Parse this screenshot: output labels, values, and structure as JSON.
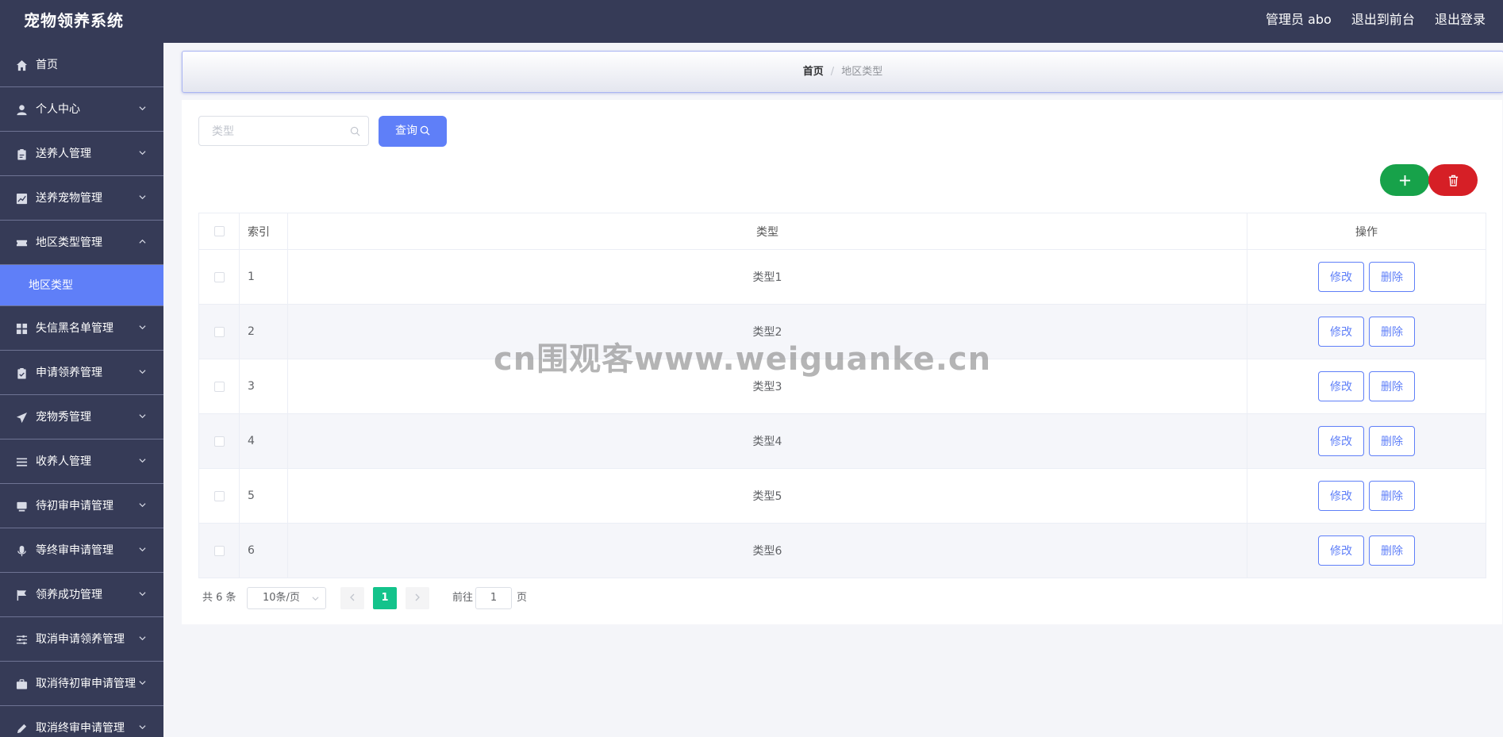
{
  "header": {
    "title": "宠物领养系统",
    "user": "管理员 abo",
    "front_link": "退出到前台",
    "logout_link": "退出登录"
  },
  "sidebar": {
    "items": [
      {
        "label": "首页",
        "icon": "home-icon"
      },
      {
        "label": "个人中心",
        "icon": "user-icon"
      },
      {
        "label": "送养人管理",
        "icon": "clipboard-icon"
      },
      {
        "label": "送养宠物管理",
        "icon": "chart-icon"
      },
      {
        "label": "地区类型管理",
        "icon": "ticket-icon",
        "expanded": true
      },
      {
        "label": "失信黑名单管理",
        "icon": "grid-icon"
      },
      {
        "label": "申请领养管理",
        "icon": "clipboard-check-icon"
      },
      {
        "label": "宠物秀管理",
        "icon": "send-icon"
      },
      {
        "label": "收养人管理",
        "icon": "list-icon"
      },
      {
        "label": "待初审申请管理",
        "icon": "monitor-icon"
      },
      {
        "label": "等终审申请管理",
        "icon": "microphone-icon"
      },
      {
        "label": "领养成功管理",
        "icon": "flag-icon"
      },
      {
        "label": "取消申请领养管理",
        "icon": "sliders-icon"
      },
      {
        "label": "取消待初审申请管理",
        "icon": "briefcase-icon"
      },
      {
        "label": "取消终审申请管理",
        "icon": "edit-icon"
      }
    ],
    "active_sub": "地区类型"
  },
  "breadcrumb": {
    "home": "首页",
    "separator": "/",
    "current": "地区类型"
  },
  "search": {
    "placeholder": "类型",
    "value": "",
    "button_label": "查询"
  },
  "table": {
    "headers": {
      "index": "索引",
      "type": "类型",
      "ops": "操作"
    },
    "rows": [
      {
        "index": "1",
        "type": "类型1"
      },
      {
        "index": "2",
        "type": "类型2"
      },
      {
        "index": "3",
        "type": "类型3"
      },
      {
        "index": "4",
        "type": "类型4"
      },
      {
        "index": "5",
        "type": "类型5"
      },
      {
        "index": "6",
        "type": "类型6"
      }
    ],
    "edit_label": "修改",
    "delete_label": "删除"
  },
  "pagination": {
    "total": "共 6 条",
    "page_size": "10条/页",
    "current_page": "1",
    "goto_label": "前往",
    "goto_value": "1",
    "page_unit": "页"
  },
  "watermark": "cn围观客www.weiguanke.cn",
  "colors": {
    "header_bg": "#363b57",
    "accent": "#5f7ff8",
    "add_button": "#17a24a",
    "delete_button": "#d61f26",
    "page_active": "#13c38b"
  }
}
